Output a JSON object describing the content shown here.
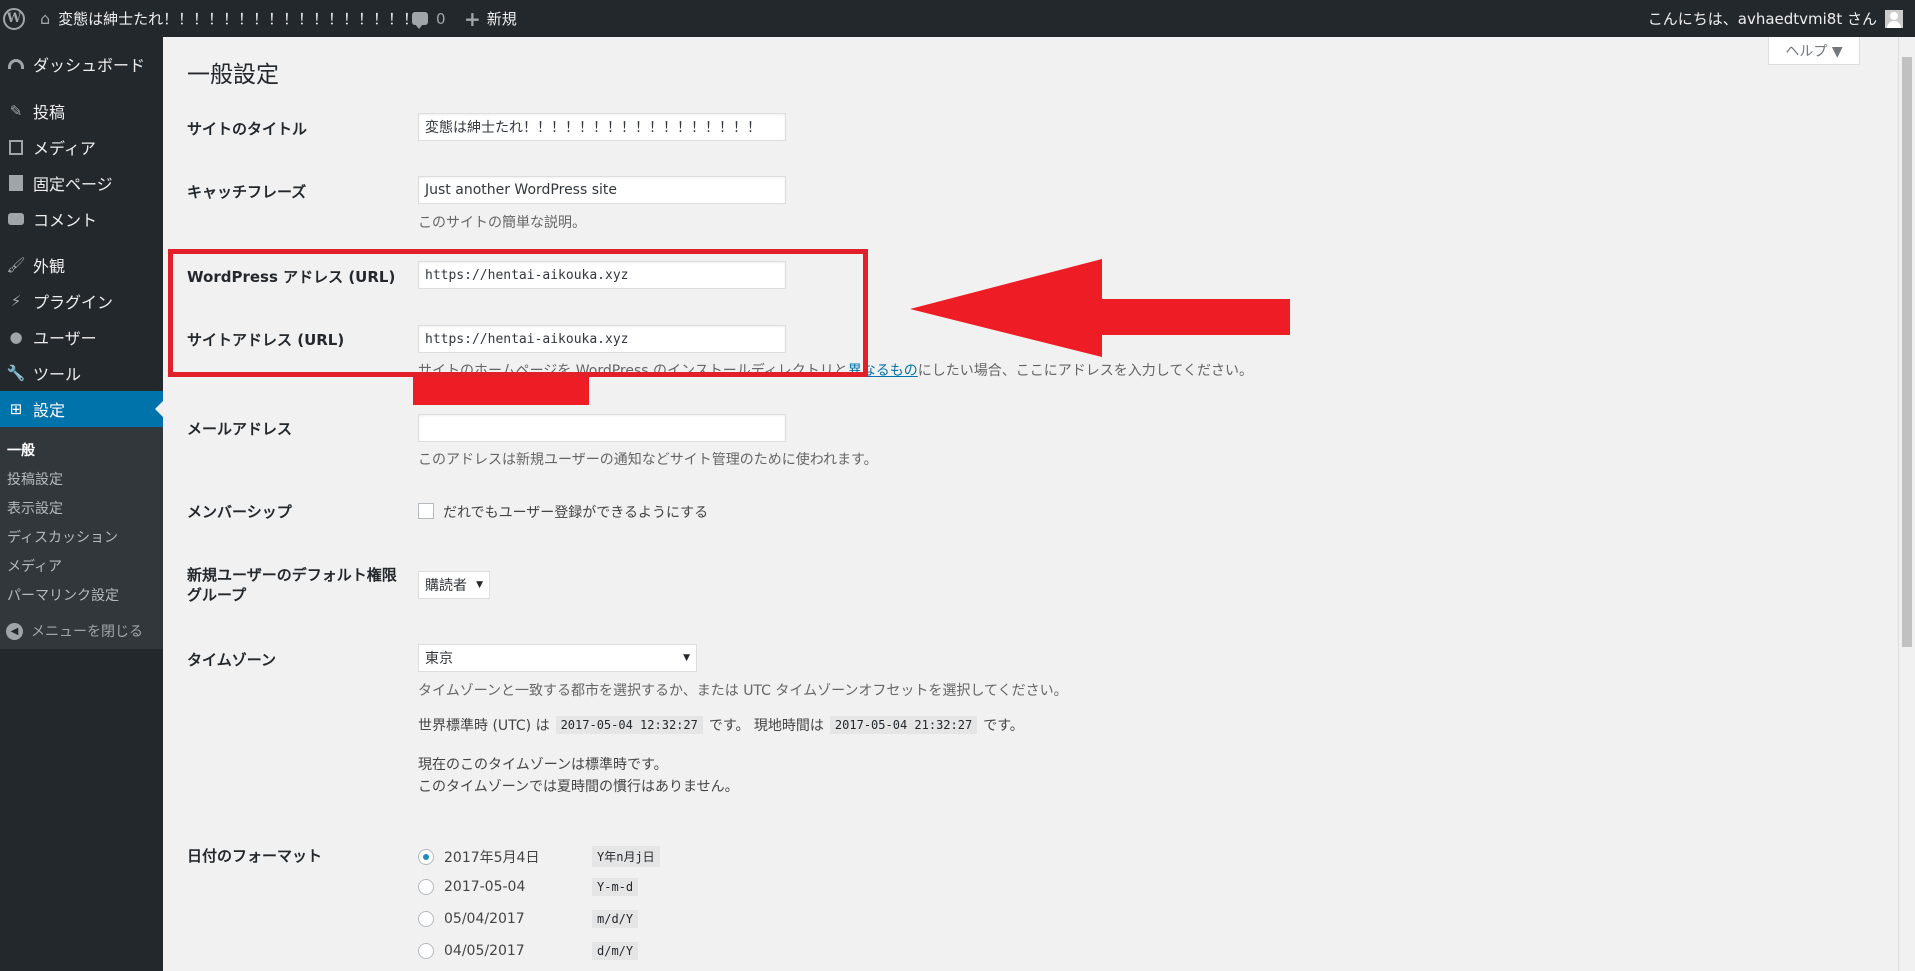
{
  "adminbar": {
    "site_name": "変態は紳士たれ！！！！！！！！！！！！！！！！！",
    "comments_count": "0",
    "new_label": "新規",
    "greeting": "こんにちは、avhaedtvmi8t さん"
  },
  "sidebar": {
    "items": [
      {
        "label": "ダッシュボード",
        "icon": "dashboard-icon"
      },
      {
        "label": "投稿",
        "icon": "pushpin-icon"
      },
      {
        "label": "メディア",
        "icon": "media-icon"
      },
      {
        "label": "固定ページ",
        "icon": "page-icon"
      },
      {
        "label": "コメント",
        "icon": "comment-icon"
      },
      {
        "label": "外観",
        "icon": "brush-icon"
      },
      {
        "label": "プラグイン",
        "icon": "plugin-icon"
      },
      {
        "label": "ユーザー",
        "icon": "user-icon"
      },
      {
        "label": "ツール",
        "icon": "wrench-icon"
      },
      {
        "label": "設定",
        "icon": "settings-icon"
      }
    ],
    "submenu": [
      "一般",
      "投稿設定",
      "表示設定",
      "ディスカッション",
      "メディア",
      "パーマリンク設定"
    ],
    "collapse_label": "メニューを閉じる"
  },
  "help_label": "ヘルプ ▼",
  "page_title": "一般設定",
  "fields": {
    "site_title": {
      "label": "サイトのタイトル",
      "value": "変態は紳士たれ！！！！！！！！！！！！！！！！！"
    },
    "tagline": {
      "label": "キャッチフレーズ",
      "value": "Just another WordPress site",
      "desc": "このサイトの簡単な説明。"
    },
    "wp_address": {
      "label": "WordPress アドレス (URL)",
      "value": "https://hentai-aikouka.xyz"
    },
    "site_address": {
      "label": "サイトアドレス (URL)",
      "value": "https://hentai-aikouka.xyz",
      "desc_prefix": "サイトのホームページを WordPress のインストールディレクトリと",
      "desc_link": "異なるもの",
      "desc_suffix": "にしたい場合、ここにアドレスを入力してください。"
    },
    "email": {
      "label": "メールアドレス",
      "desc": "このアドレスは新規ユーザーの通知などサイト管理のために使われます。"
    },
    "membership": {
      "label": "メンバーシップ",
      "checkbox_label": "だれでもユーザー登録ができるようにする"
    },
    "default_role": {
      "label_line1": "新規ユーザーのデフォルト権限",
      "label_line2": "グループ",
      "value": "購読者"
    },
    "timezone": {
      "label": "タイムゾーン",
      "value": "東京",
      "desc": "タイムゾーンと一致する都市を選択するか、または UTC タイムゾーンオフセットを選択してください。",
      "utc_label": "世界標準時 (UTC) は",
      "utc_time": "2017-05-04 12:32:27",
      "local_label": "です。 現地時間は",
      "local_time": "2017-05-04 21:32:27",
      "local_suffix": "です。",
      "note1": "現在のこのタイムゾーンは標準時です。",
      "note2": "このタイムゾーンでは夏時間の慣行はありません。"
    },
    "date_format": {
      "label": "日付のフォーマット",
      "options": [
        {
          "display": "2017年5月4日",
          "code": "Y年n月j日",
          "checked": true
        },
        {
          "display": "2017-05-04",
          "code": "Y-m-d",
          "checked": false
        },
        {
          "display": "05/04/2017",
          "code": "m/d/Y",
          "checked": false
        },
        {
          "display": "04/05/2017",
          "code": "d/m/Y",
          "checked": false
        }
      ]
    }
  },
  "colors": {
    "accent": "#0073aa",
    "annotation_red": "#e2202a",
    "sidebar_bg": "#23282d"
  }
}
